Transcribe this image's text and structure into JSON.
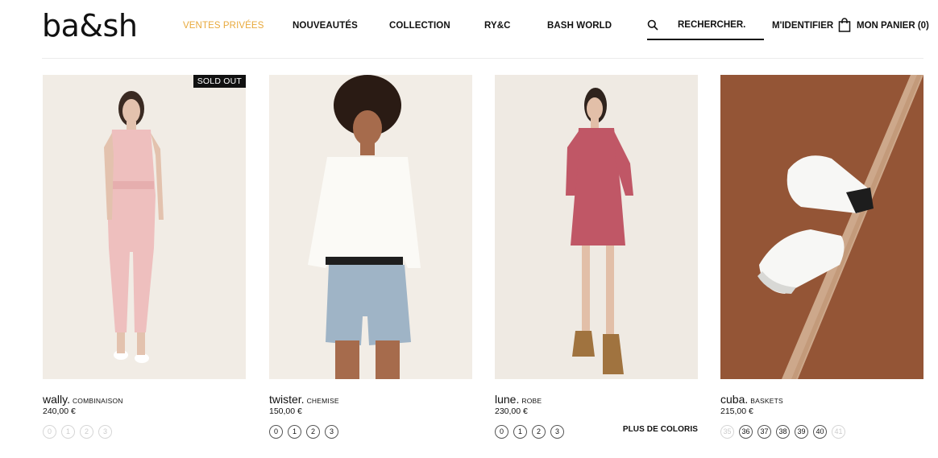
{
  "brand": {
    "logo_text": "ba&sh"
  },
  "nav": [
    {
      "label": "VENTES PRIVÉES"
    },
    {
      "label": "NOUVEAUTÉS"
    },
    {
      "label": "COLLECTION"
    },
    {
      "label": "RY&C"
    },
    {
      "label": "BASH WORLD"
    }
  ],
  "search": {
    "label": "RECHERCHER.",
    "icon": "search-icon"
  },
  "account": {
    "login_label": "M'IDENTIFIER",
    "cart_label": "MON PANIER (0)",
    "cart_icon": "shopping-bag-icon"
  },
  "colors": {
    "accent": "#e8a93c",
    "text": "#111111",
    "disabled": "#cccccc"
  },
  "products": [
    {
      "name": "wally.",
      "category": "COMBINAISON",
      "price": "240,00 €",
      "badge": "SOLD OUT",
      "sizes": [
        {
          "label": "0",
          "available": false
        },
        {
          "label": "1",
          "available": false
        },
        {
          "label": "2",
          "available": false
        },
        {
          "label": "3",
          "available": false
        }
      ]
    },
    {
      "name": "twister.",
      "category": "CHEMISE",
      "price": "150,00 €",
      "sizes": [
        {
          "label": "0",
          "available": true
        },
        {
          "label": "1",
          "available": true
        },
        {
          "label": "2",
          "available": true
        },
        {
          "label": "3",
          "available": true
        }
      ]
    },
    {
      "name": "lune.",
      "category": "ROBE",
      "price": "230,00 €",
      "more_colors": "PLUS DE COLORIS",
      "sizes": [
        {
          "label": "0",
          "available": true
        },
        {
          "label": "1",
          "available": true
        },
        {
          "label": "2",
          "available": true
        },
        {
          "label": "3",
          "available": true
        }
      ]
    },
    {
      "name": "cuba.",
      "category": "BASKETS",
      "price": "215,00 €",
      "sizes": [
        {
          "label": "35",
          "available": false
        },
        {
          "label": "36",
          "available": true
        },
        {
          "label": "37",
          "available": true
        },
        {
          "label": "38",
          "available": true
        },
        {
          "label": "39",
          "available": true
        },
        {
          "label": "40",
          "available": true
        },
        {
          "label": "41",
          "available": false
        }
      ]
    }
  ]
}
